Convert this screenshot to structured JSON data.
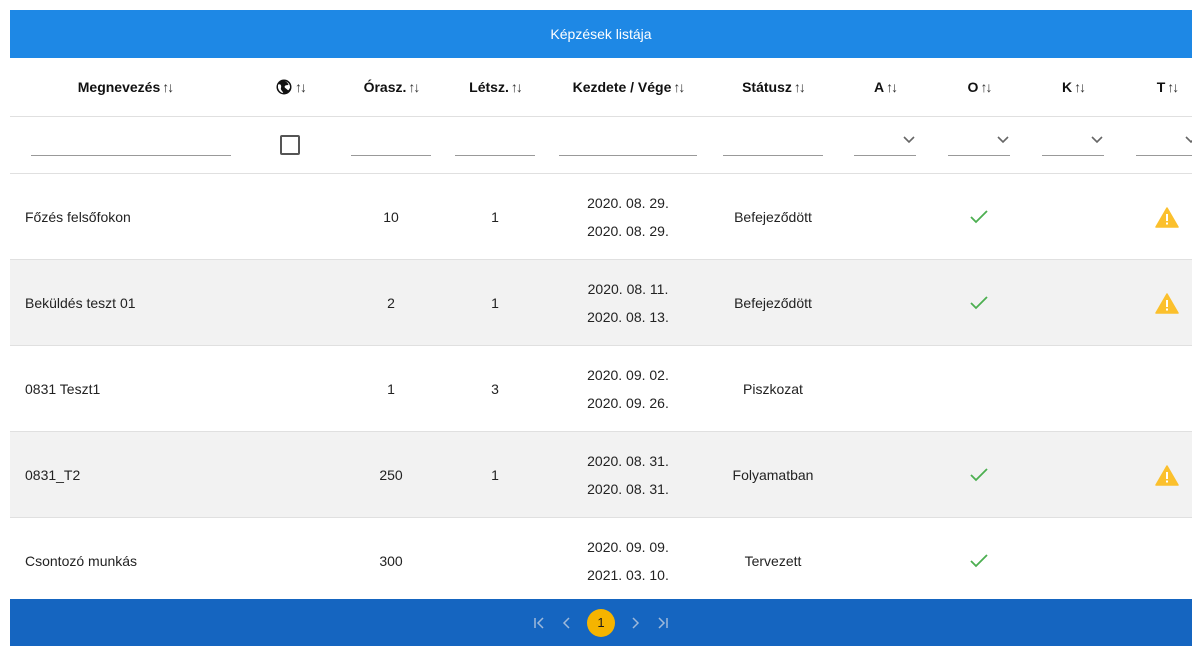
{
  "title": "Képzések listája",
  "columns": {
    "name": "Megnevezés",
    "hours": "Órasz.",
    "headcount": "Létsz.",
    "dates": "Kezdete / Vége",
    "status": "Státusz",
    "a": "A",
    "o": "O",
    "k": "K",
    "t": "T"
  },
  "sort_glyph": "↑↓",
  "rows": [
    {
      "name": "Főzés felsőfokon",
      "hours": "10",
      "headcount": "1",
      "start": "2020. 08. 29.",
      "end": "2020. 08. 29.",
      "status": "Befejeződött"
    },
    {
      "name": "Beküldés teszt 01",
      "hours": "2",
      "headcount": "1",
      "start": "2020. 08. 11.",
      "end": "2020. 08. 13.",
      "status": "Befejeződött"
    },
    {
      "name": "0831 Teszt1",
      "hours": "1",
      "headcount": "3",
      "start": "2020. 09. 02.",
      "end": "2020. 09. 26.",
      "status": "Piszkozat"
    },
    {
      "name": "0831_T2",
      "hours": "250",
      "headcount": "1",
      "start": "2020. 08. 31.",
      "end": "2020. 08. 31.",
      "status": "Folyamatban"
    },
    {
      "name": "Csontozó munkás",
      "hours": "300",
      "headcount": "",
      "start": "2020. 09. 09.",
      "end": "2021. 03. 10.",
      "status": "Tervezett"
    }
  ],
  "pagination": {
    "current": "1"
  },
  "colors": {
    "header": "#1e88e5",
    "footer": "#1565c0",
    "check": "#4caf50",
    "warning": "#fbc02d",
    "current_page": "#f5b400"
  }
}
